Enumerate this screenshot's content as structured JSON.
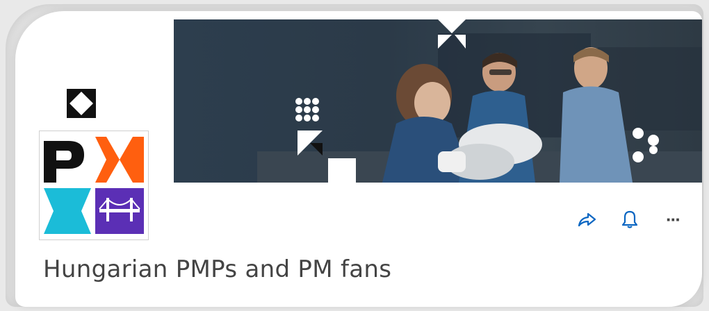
{
  "group": {
    "name": "Hungarian PMPs and PM fans",
    "logo_letter": "P"
  },
  "actions": {
    "share_icon": "share-icon",
    "notify_icon": "bell-icon",
    "more_label": "···"
  },
  "colors": {
    "accent": "#0a66c2",
    "logo_orange": "#ff5f0f",
    "logo_cyan": "#1bbcd8",
    "logo_purple": "#5b2fb5",
    "text": "#444444"
  }
}
